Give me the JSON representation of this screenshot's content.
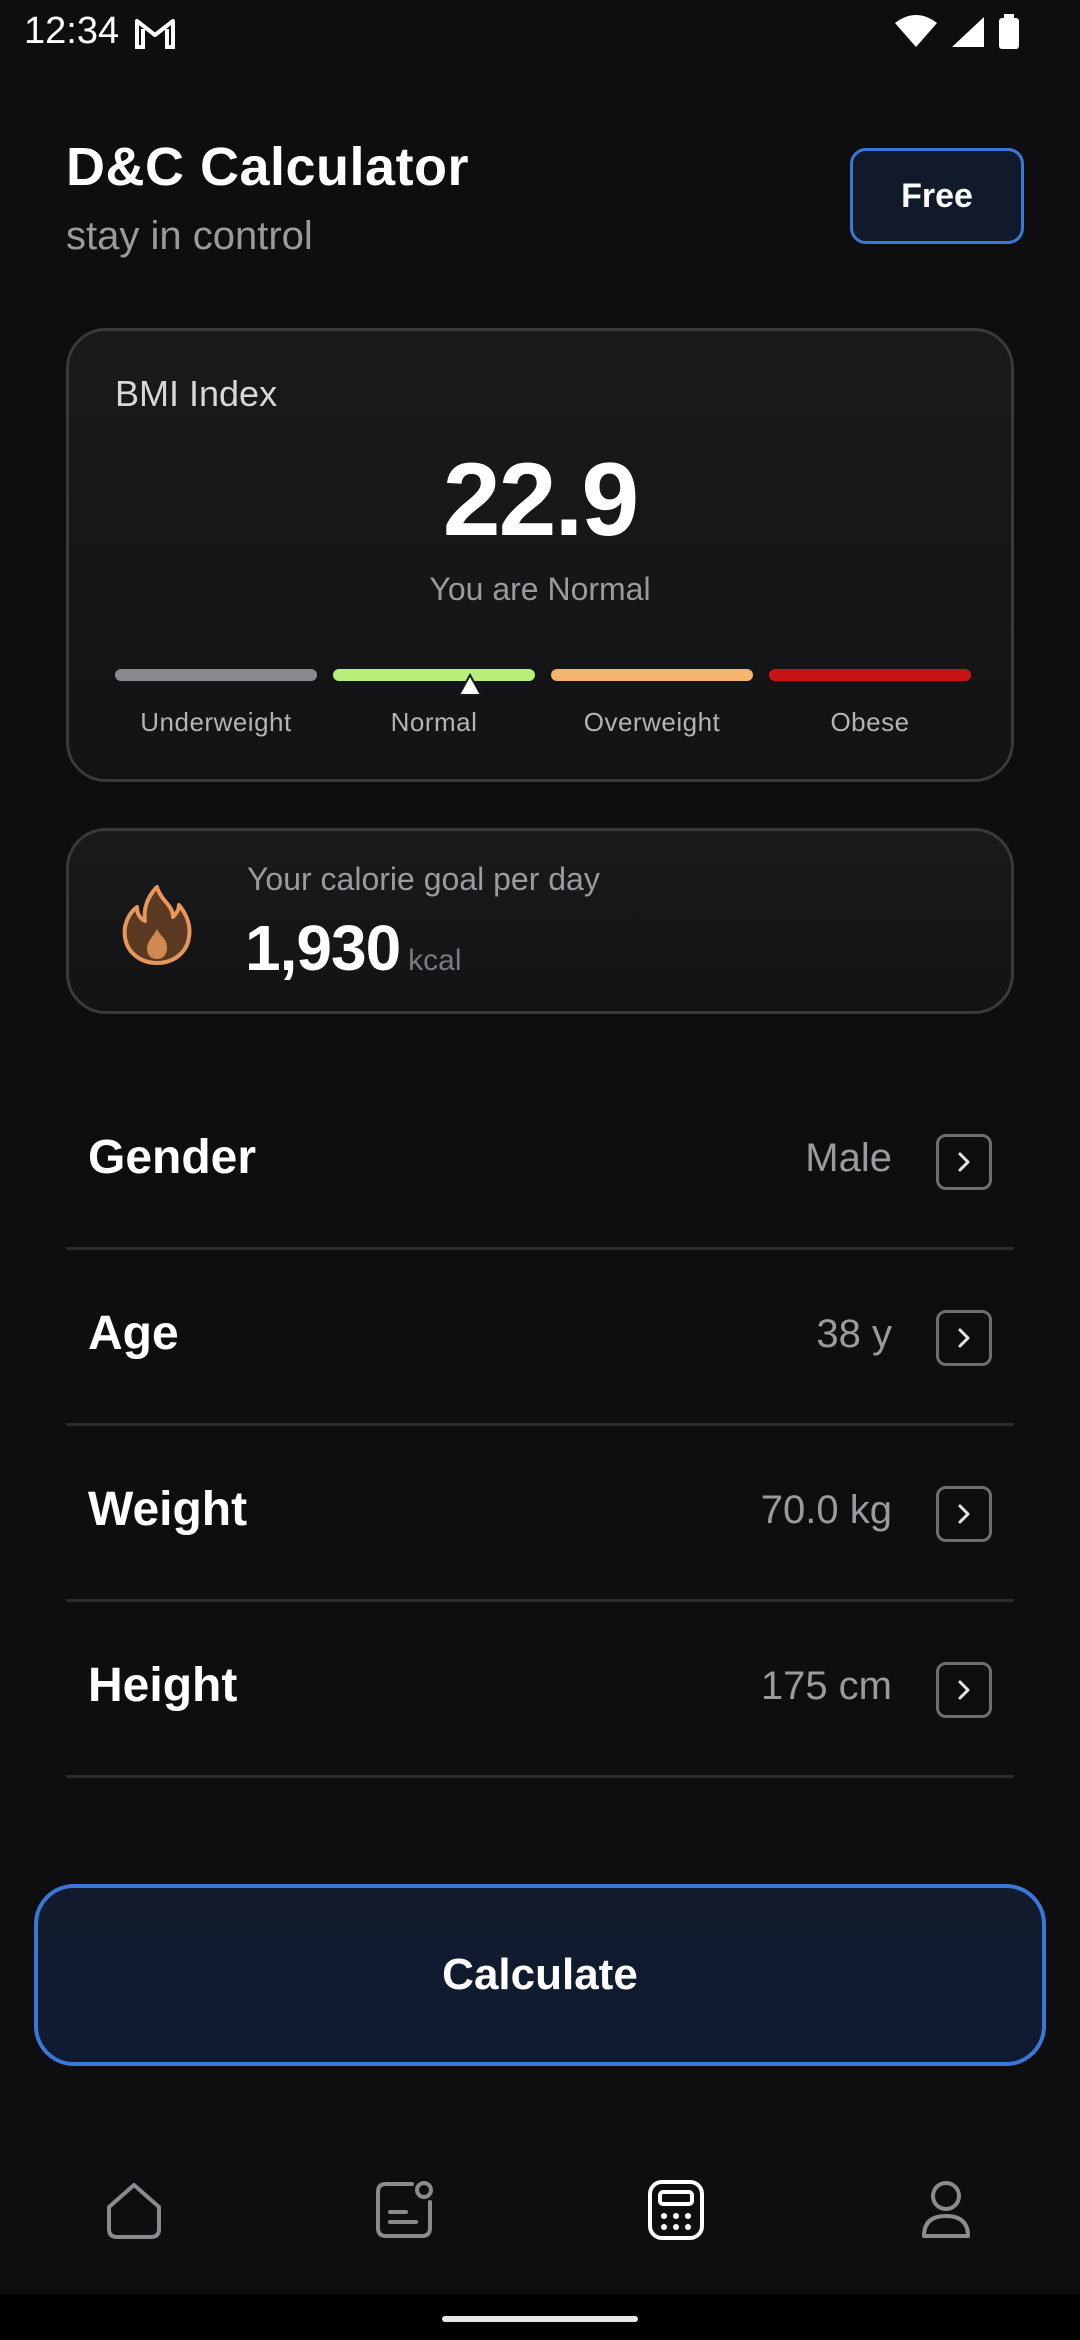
{
  "status_bar": {
    "time": "12:34"
  },
  "header": {
    "title": "D&C Calculator",
    "subtitle": "stay in control",
    "plan_label": "Free"
  },
  "bmi": {
    "title": "BMI Index",
    "value": "22.9",
    "status_text": "You are Normal",
    "categories": [
      {
        "label": "Underweight",
        "color": "#8a8a8e"
      },
      {
        "label": "Normal",
        "color": "#b6f07a"
      },
      {
        "label": "Overweight",
        "color": "#f6b56f"
      },
      {
        "label": "Obese",
        "color": "#c81414"
      }
    ],
    "current_category": "Normal"
  },
  "calorie": {
    "label": "Your calorie goal per day",
    "value": "1,930",
    "unit": "kcal"
  },
  "fields": [
    {
      "label": "Gender",
      "value": "Male"
    },
    {
      "label": "Age",
      "value": "38 y"
    },
    {
      "label": "Weight",
      "value": "70.0 kg"
    },
    {
      "label": "Height",
      "value": "175 cm"
    }
  ],
  "calculate_label": "Calculate",
  "bottom_nav": [
    {
      "icon": "home-icon",
      "active": false
    },
    {
      "icon": "journal-icon",
      "active": false
    },
    {
      "icon": "calculator-icon",
      "active": true
    },
    {
      "icon": "profile-icon",
      "active": false
    }
  ],
  "colors": {
    "accent": "#3a78d8",
    "background": "#0e0e10",
    "flame": "#e8975a"
  }
}
